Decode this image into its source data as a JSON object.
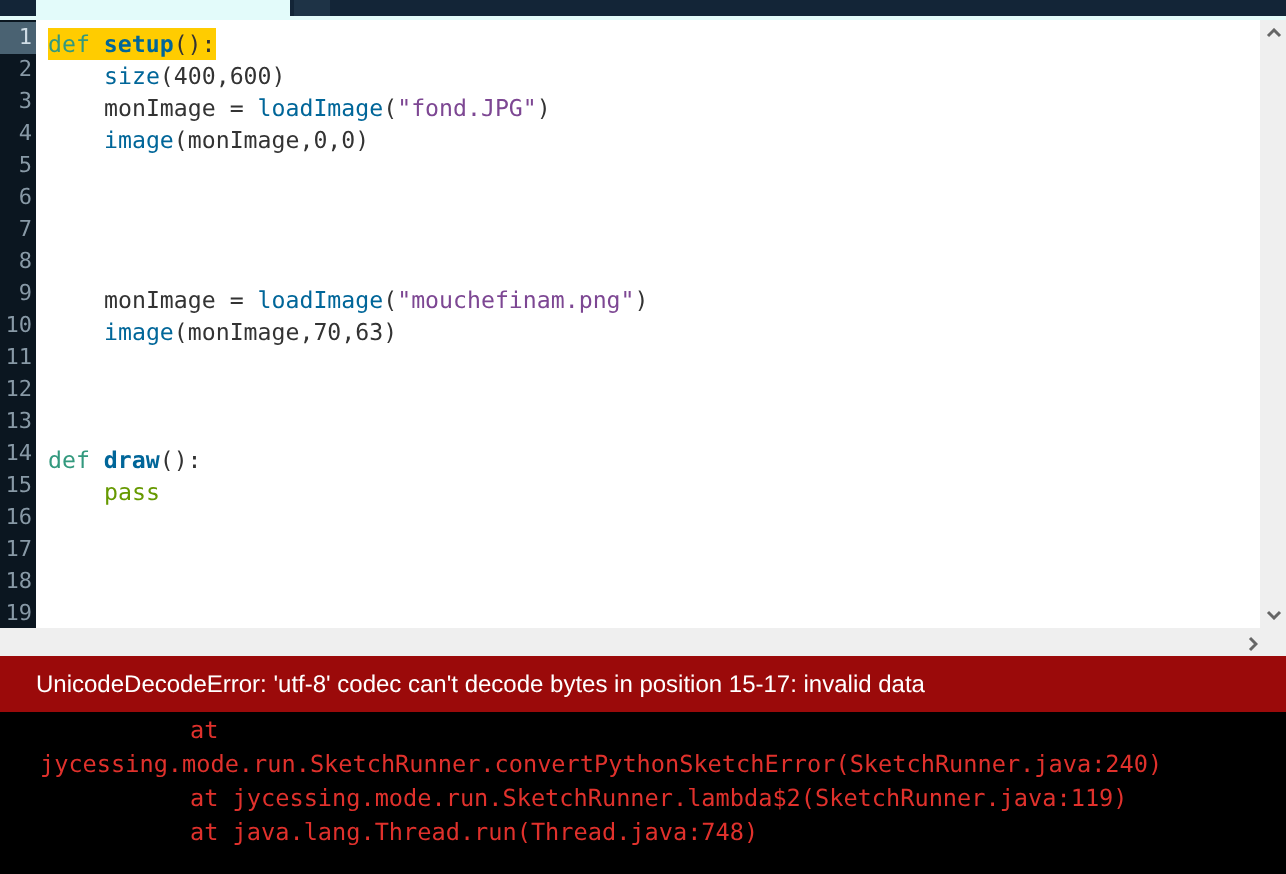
{
  "editor": {
    "tabs": [
      {
        "selected": true
      },
      {
        "selected": false
      }
    ],
    "lines": [
      {
        "number": "1",
        "current": true,
        "tokens": [
          {
            "kind": "keyword",
            "text": "def"
          },
          {
            "kind": "defname",
            "text": "setup"
          },
          {
            "kind": "plain",
            "text": "():"
          }
        ]
      },
      {
        "number": "2",
        "current": false,
        "indented": true,
        "tokens": [
          {
            "kind": "call",
            "text": "size"
          },
          {
            "kind": "plain",
            "text": "(400,600)"
          }
        ]
      },
      {
        "number": "3",
        "current": false,
        "indented": true,
        "tokens": [
          {
            "kind": "plain",
            "text": "monImage = "
          },
          {
            "kind": "call",
            "text": "loadImage"
          },
          {
            "kind": "plain",
            "text": "("
          },
          {
            "kind": "string",
            "text": "\"fond.JPG\""
          },
          {
            "kind": "plain",
            "text": ")"
          }
        ]
      },
      {
        "number": "4",
        "current": false,
        "indented": true,
        "tokens": [
          {
            "kind": "call",
            "text": "image"
          },
          {
            "kind": "plain",
            "text": "(monImage,0,0)"
          }
        ]
      },
      {
        "number": "5",
        "current": false
      },
      {
        "number": "6",
        "current": false
      },
      {
        "number": "7",
        "current": false
      },
      {
        "number": "8",
        "current": false
      },
      {
        "number": "9",
        "current": false,
        "indented": true,
        "tokens": [
          {
            "kind": "plain",
            "text": "monImage = "
          },
          {
            "kind": "call",
            "text": "loadImage"
          },
          {
            "kind": "plain",
            "text": "("
          },
          {
            "kind": "string",
            "text": "\"mouchefinam.png\""
          },
          {
            "kind": "plain",
            "text": ")"
          }
        ]
      },
      {
        "number": "10",
        "current": false,
        "indented": true,
        "tokens": [
          {
            "kind": "call",
            "text": "image"
          },
          {
            "kind": "plain",
            "text": "(monImage,70,63)"
          }
        ]
      },
      {
        "number": "11",
        "current": false
      },
      {
        "number": "12",
        "current": false
      },
      {
        "number": "13",
        "current": false
      },
      {
        "number": "14",
        "current": false,
        "tokens": [
          {
            "kind": "keyword",
            "text": "def"
          },
          {
            "kind": "defname",
            "text": "draw"
          },
          {
            "kind": "plain",
            "text": "():"
          }
        ]
      },
      {
        "number": "15",
        "current": false,
        "indented": true,
        "tokens": [
          {
            "kind": "literal",
            "text": "pass"
          }
        ]
      },
      {
        "number": "16",
        "current": false
      },
      {
        "number": "17",
        "current": false
      },
      {
        "number": "18",
        "current": false
      },
      {
        "number": "19",
        "current": false
      }
    ]
  },
  "error_bar": {
    "message": "UnicodeDecodeError: 'utf-8' codec can't decode bytes in position 15-17: invalid data"
  },
  "console": {
    "lines": [
      {
        "text": "at",
        "indented": true
      },
      {
        "text": "jycessing.mode.run.SketchRunner.convertPythonSketchError(SketchRunner.java:240)",
        "indented": false
      },
      {
        "text": "at jycessing.mode.run.SketchRunner.lambda$2(SketchRunner.java:119)",
        "indented": true
      },
      {
        "text": "at java.lang.Thread.run(Thread.java:748)",
        "indented": true
      }
    ]
  }
}
